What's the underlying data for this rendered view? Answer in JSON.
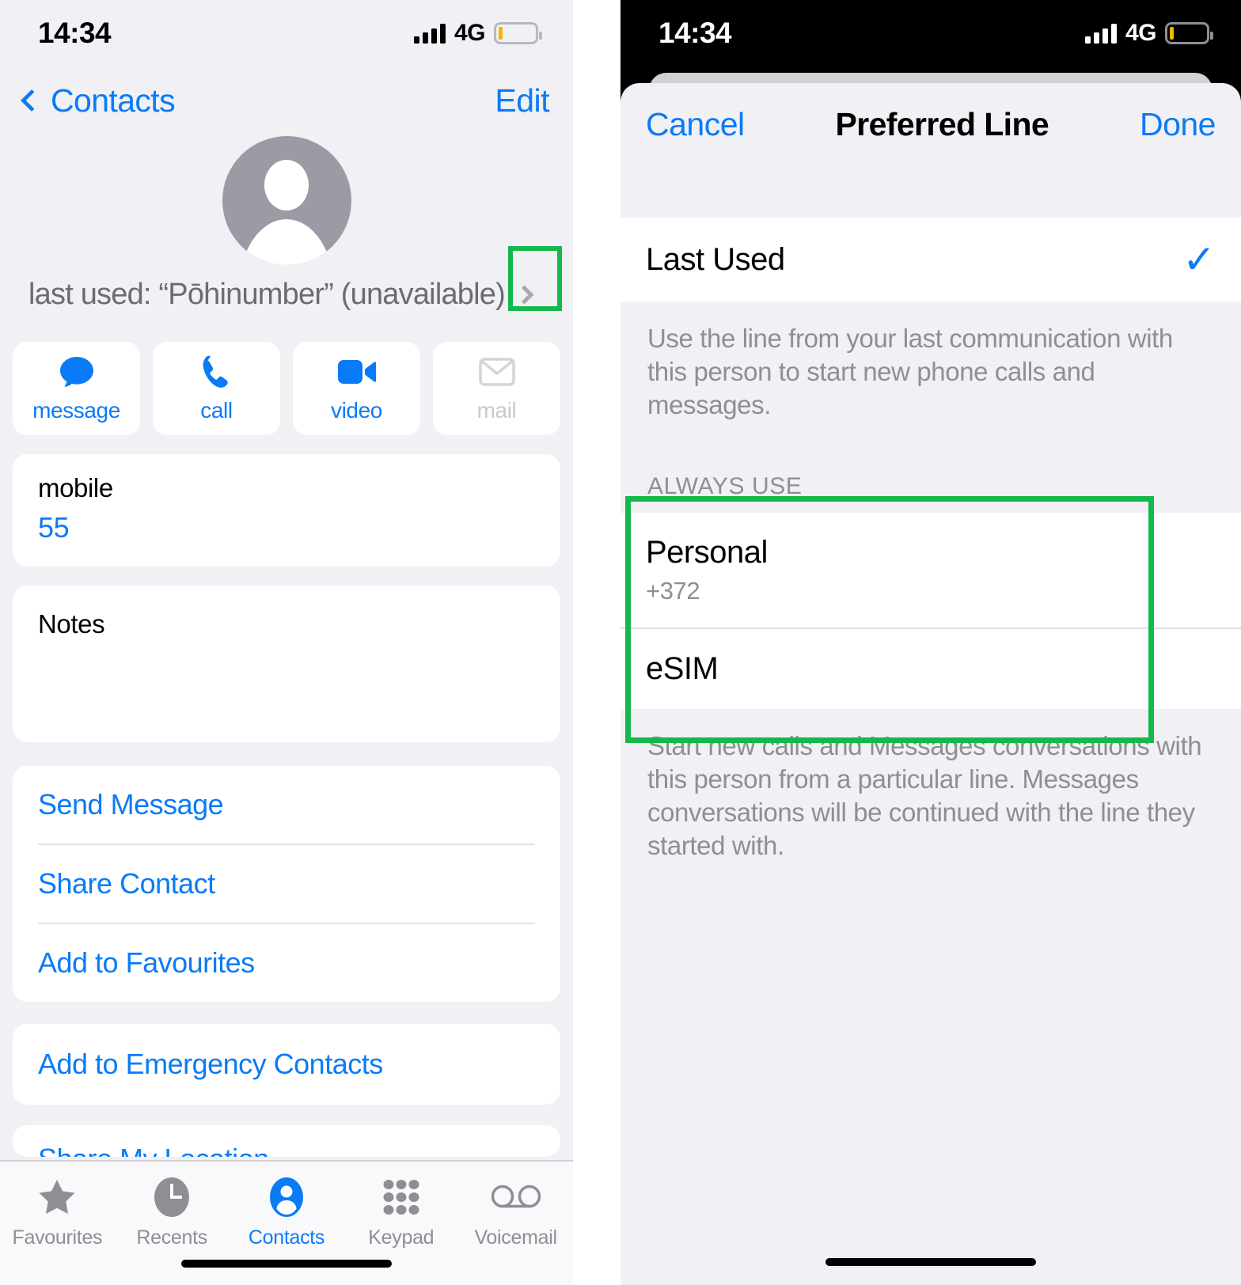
{
  "left_screen": {
    "status_bar": {
      "time": "14:34",
      "network": "4G",
      "battery_level_pct": 12,
      "signal_bars": 4
    },
    "nav": {
      "back_label": "Contacts",
      "edit_label": "Edit"
    },
    "contact": {
      "avatar": "person-placeholder",
      "last_used_text": "last used: “Pōhinumber” (unavailable)",
      "disclosure": "chevron-right"
    },
    "actions": [
      {
        "label": "message",
        "icon": "message-bubble-icon",
        "enabled": true
      },
      {
        "label": "call",
        "icon": "phone-icon",
        "enabled": true
      },
      {
        "label": "video",
        "icon": "video-camera-icon",
        "enabled": true
      },
      {
        "label": "mail",
        "icon": "envelope-icon",
        "enabled": false
      }
    ],
    "phone_card": {
      "label": "mobile",
      "value": "55"
    },
    "notes_card": {
      "label": "Notes",
      "value": ""
    },
    "link_group": [
      {
        "label": "Send Message"
      },
      {
        "label": "Share Contact"
      },
      {
        "label": "Add to Favourites"
      }
    ],
    "emergency_group": [
      {
        "label": "Add to Emergency Contacts"
      }
    ],
    "clipped_group": [
      {
        "label": "Share My Location"
      }
    ],
    "tab_bar": [
      {
        "label": "Favourites",
        "icon": "star-icon",
        "active": false
      },
      {
        "label": "Recents",
        "icon": "clock-icon",
        "active": false
      },
      {
        "label": "Contacts",
        "icon": "person-circle-icon",
        "active": true
      },
      {
        "label": "Keypad",
        "icon": "keypad-grid-icon",
        "active": false
      },
      {
        "label": "Voicemail",
        "icon": "voicemail-icon",
        "active": false
      }
    ]
  },
  "right_screen": {
    "status_bar": {
      "time": "14:34",
      "network": "4G",
      "battery_level_pct": 12,
      "signal_bars": 4
    },
    "sheet": {
      "cancel_label": "Cancel",
      "title": "Preferred Line",
      "done_label": "Done",
      "last_used": {
        "label": "Last Used",
        "selected": true,
        "checkmark": "check-icon"
      },
      "last_used_footnote": "Use the line from your last communication with this person to start new phone calls and messages.",
      "always_use_header": "ALWAYS USE",
      "lines": [
        {
          "label": "Personal",
          "subtitle": "+372"
        },
        {
          "label": "eSIM",
          "subtitle": ""
        }
      ],
      "always_use_footnote": "Start new calls and Messages conversations with this person from a particular line. Messages conversations will be continued with the line they started with."
    }
  },
  "annotations": {
    "highlight_color": "#15b84b",
    "boxes": [
      {
        "name": "preferred-line-disclosure-highlight",
        "target": "contact.disclosure"
      },
      {
        "name": "always-use-section-highlight",
        "target": "sheet.always_use"
      }
    ]
  },
  "theme": {
    "accent_blue": "#0a7bf7",
    "grey_text": "#8e8e93",
    "bg": "#f0f0f5",
    "battery_low": "#f7b500"
  }
}
